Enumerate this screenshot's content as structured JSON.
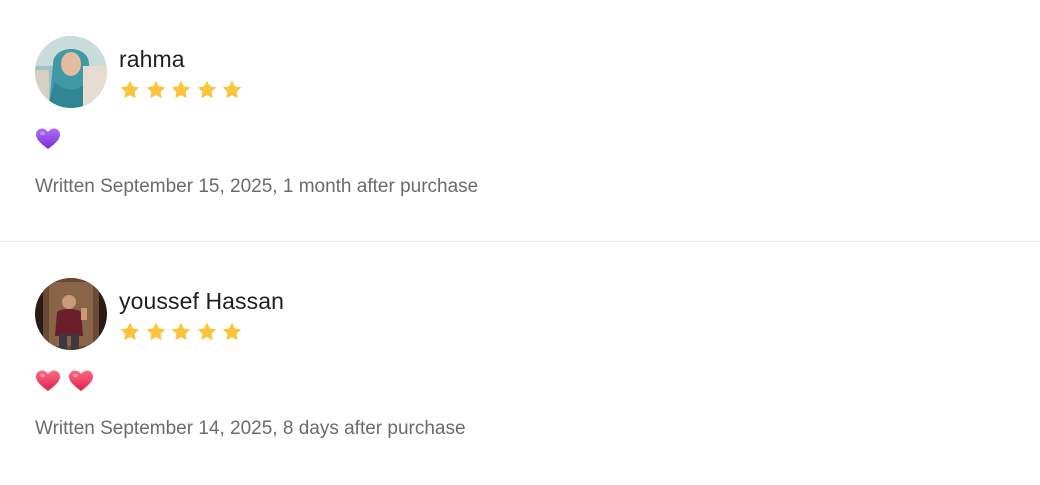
{
  "reviews": [
    {
      "author": "rahma",
      "rating": 5,
      "body_emoji": [
        "purple-heart"
      ],
      "written": "Written September 15, 2025, 1 month after purchase"
    },
    {
      "author": "youssef Hassan",
      "rating": 5,
      "body_emoji": [
        "red-heart",
        "red-heart"
      ],
      "written": "Written September 14, 2025, 8 days after purchase"
    }
  ],
  "colors": {
    "star": "#FCC33C",
    "purple_heart": "#8E3FE6",
    "red_heart": "#F0305A",
    "divider": "#E6E6E6",
    "muted_text": "#6B6B6B"
  }
}
